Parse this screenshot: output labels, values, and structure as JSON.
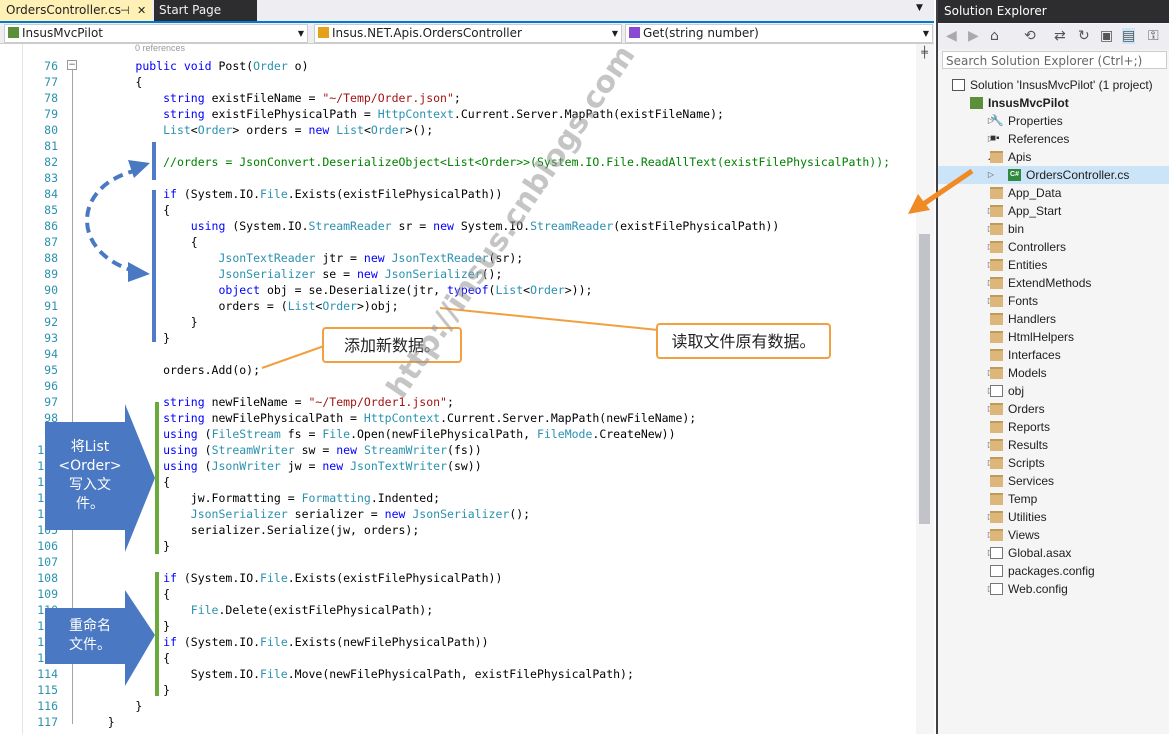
{
  "tabs": [
    {
      "label": "OrdersController.cs",
      "pin_glyph": "⊣",
      "close_glyph": "✕",
      "active": true
    },
    {
      "label": "Start Page",
      "active": false
    }
  ],
  "navbar": {
    "project": "InsusMvcPilot",
    "class": "Insus.NET.Apis.OrdersController",
    "member": "Get(string number)"
  },
  "editor": {
    "codelens": "0 references",
    "lines": [
      {
        "n": "76",
        "html": "        <span class=\"k\">public</span> <span class=\"k\">void</span> Post(<span class=\"t\">Order</span> o)"
      },
      {
        "n": "77",
        "html": "        {"
      },
      {
        "n": "78",
        "html": "            <span class=\"k\">string</span> existFileName = <span class=\"s\">\"~/Temp/Order.json\"</span>;"
      },
      {
        "n": "79",
        "html": "            <span class=\"k\">string</span> existFilePhysicalPath = <span class=\"t\">HttpContext</span>.Current.Server.MapPath(existFileName);"
      },
      {
        "n": "80",
        "html": "            <span class=\"t\">List</span>&lt;<span class=\"t\">Order</span>&gt; orders = <span class=\"k\">new</span> <span class=\"t\">List</span>&lt;<span class=\"t\">Order</span>&gt;();"
      },
      {
        "n": "81",
        "html": ""
      },
      {
        "n": "82",
        "html": "            <span class=\"c\">//orders = JsonConvert.DeserializeObject&lt;List&lt;Order&gt;&gt;(System.IO.File.ReadAllText(existFilePhysicalPath));</span>"
      },
      {
        "n": "83",
        "html": ""
      },
      {
        "n": "84",
        "html": "            <span class=\"k\">if</span> (System.IO.<span class=\"t\">File</span>.Exists(existFilePhysicalPath))"
      },
      {
        "n": "85",
        "html": "            {"
      },
      {
        "n": "86",
        "html": "                <span class=\"k\">using</span> (System.IO.<span class=\"t\">StreamReader</span> sr = <span class=\"k\">new</span> System.IO.<span class=\"t\">StreamReader</span>(existFilePhysicalPath))"
      },
      {
        "n": "87",
        "html": "                {"
      },
      {
        "n": "88",
        "html": "                    <span class=\"t\">JsonTextReader</span> jtr = <span class=\"k\">new</span> <span class=\"t\">JsonTextReader</span>(sr);"
      },
      {
        "n": "89",
        "html": "                    <span class=\"t\">JsonSerializer</span> se = <span class=\"k\">new</span> <span class=\"t\">JsonSerializer</span>();"
      },
      {
        "n": "90",
        "html": "                    <span class=\"k\">object</span> obj = se.Deserialize(jtr, <span class=\"k\">typeof</span>(<span class=\"t\">List</span>&lt;<span class=\"t\">Order</span>&gt;));"
      },
      {
        "n": "91",
        "html": "                    orders = (<span class=\"t\">List</span>&lt;<span class=\"t\">Order</span>&gt;)obj;"
      },
      {
        "n": "92",
        "html": "                }"
      },
      {
        "n": "93",
        "html": "            }"
      },
      {
        "n": "94",
        "html": ""
      },
      {
        "n": "95",
        "html": "            orders.Add(o);"
      },
      {
        "n": "96",
        "html": ""
      },
      {
        "n": "97",
        "html": "            <span class=\"k\">string</span> newFileName = <span class=\"s\">\"~/Temp/Order1.json\"</span>;"
      },
      {
        "n": "98",
        "html": "            <span class=\"k\">string</span> newFilePhysicalPath = <span class=\"t\">HttpContext</span>.Current.Server.MapPath(newFileName);"
      },
      {
        "n": "99",
        "html": "            <span class=\"k\">using</span> (<span class=\"t\">FileStream</span> fs = <span class=\"t\">File</span>.Open(newFilePhysicalPath, <span class=\"t\">FileMode</span>.CreateNew))"
      },
      {
        "n": "100",
        "html": "            <span class=\"k\">using</span> (<span class=\"t\">StreamWriter</span> sw = <span class=\"k\">new</span> <span class=\"t\">StreamWriter</span>(fs))"
      },
      {
        "n": "101",
        "html": "            <span class=\"k\">using</span> (<span class=\"t\">JsonWriter</span> jw = <span class=\"k\">new</span> <span class=\"t\">JsonTextWriter</span>(sw))"
      },
      {
        "n": "102",
        "html": "            {"
      },
      {
        "n": "103",
        "html": "                jw.Formatting = <span class=\"t\">Formatting</span>.Indented;"
      },
      {
        "n": "104",
        "html": "                <span class=\"t\">JsonSerializer</span> serializer = <span class=\"k\">new</span> <span class=\"t\">JsonSerializer</span>();"
      },
      {
        "n": "105",
        "html": "                serializer.Serialize(jw, orders);"
      },
      {
        "n": "106",
        "html": "            }"
      },
      {
        "n": "107",
        "html": ""
      },
      {
        "n": "108",
        "html": "            <span class=\"k\">if</span> (System.IO.<span class=\"t\">File</span>.Exists(existFilePhysicalPath))"
      },
      {
        "n": "109",
        "html": "            {"
      },
      {
        "n": "110",
        "html": "                <span class=\"t\">File</span>.Delete(existFilePhysicalPath);"
      },
      {
        "n": "111",
        "html": "            }"
      },
      {
        "n": "112",
        "html": "            <span class=\"k\">if</span> (System.IO.<span class=\"t\">File</span>.Exists(newFilePhysicalPath))"
      },
      {
        "n": "113",
        "html": "            {"
      },
      {
        "n": "114",
        "html": "                System.IO.<span class=\"t\">File</span>.Move(newFilePhysicalPath, existFilePhysicalPath);"
      },
      {
        "n": "115",
        "html": "            }"
      },
      {
        "n": "116",
        "html": "        }"
      },
      {
        "n": "117",
        "html": "    }"
      }
    ]
  },
  "annotations": {
    "callout_add": "添加新数据。",
    "callout_read": "读取文件原有数据。",
    "arrow_write": [
      "将List",
      "<Order>",
      "写入文",
      "件。"
    ],
    "arrow_rename": [
      "重命名",
      "文件。"
    ],
    "watermark": "http://insus.cnblogs.com",
    "colors": {
      "callout_border": "#f0a040",
      "big_arrow": "#4a78c2",
      "blue_bar": "#4e7cc6",
      "green_bar": "#6aaa3a",
      "orange_arrow": "#f08a24"
    }
  },
  "solution_explorer": {
    "title": "Solution Explorer",
    "search_placeholder": "Search Solution Explorer (Ctrl+;)",
    "toolbar_icons": [
      "back-icon",
      "forward-icon",
      "home-icon",
      "history-icon",
      "sync-icon",
      "refresh-icon",
      "collapse-all-icon",
      "show-all-files-icon",
      "properties-icon"
    ],
    "items": [
      {
        "label": "Solution 'InsusMvcPilot' (1 project)",
        "level": 0,
        "icon": "solution-icon",
        "expander": ""
      },
      {
        "label": "InsusMvcPilot",
        "level": 1,
        "icon": "project-icon",
        "expander": "◢",
        "bold": true
      },
      {
        "label": "Properties",
        "level": 2,
        "icon": "wrench-icon",
        "expander": "▷"
      },
      {
        "label": "References",
        "level": 2,
        "icon": "references-icon",
        "expander": "▷"
      },
      {
        "label": "Apis",
        "level": 2,
        "icon": "folder-icon",
        "expander": "◢"
      },
      {
        "label": "OrdersController.cs",
        "level": 3,
        "icon": "csharp-file-icon",
        "expander": "▷",
        "selected": true
      },
      {
        "label": "App_Data",
        "level": 2,
        "icon": "folder-icon",
        "expander": ""
      },
      {
        "label": "App_Start",
        "level": 2,
        "icon": "folder-icon",
        "expander": "▷"
      },
      {
        "label": "bin",
        "level": 2,
        "icon": "folder-icon",
        "expander": "▷"
      },
      {
        "label": "Controllers",
        "level": 2,
        "icon": "folder-icon",
        "expander": "▷"
      },
      {
        "label": "Entities",
        "level": 2,
        "icon": "folder-icon",
        "expander": "▷"
      },
      {
        "label": "ExtendMethods",
        "level": 2,
        "icon": "folder-icon",
        "expander": "▷"
      },
      {
        "label": "Fonts",
        "level": 2,
        "icon": "folder-icon",
        "expander": "▷"
      },
      {
        "label": "Handlers",
        "level": 2,
        "icon": "folder-icon",
        "expander": ""
      },
      {
        "label": "HtmlHelpers",
        "level": 2,
        "icon": "folder-icon",
        "expander": ""
      },
      {
        "label": "Interfaces",
        "level": 2,
        "icon": "folder-icon",
        "expander": ""
      },
      {
        "label": "Models",
        "level": 2,
        "icon": "folder-icon",
        "expander": "▷"
      },
      {
        "label": "obj",
        "level": 2,
        "icon": "hidden-folder-icon",
        "expander": "▷"
      },
      {
        "label": "Orders",
        "level": 2,
        "icon": "folder-icon",
        "expander": "▷"
      },
      {
        "label": "Reports",
        "level": 2,
        "icon": "folder-icon",
        "expander": ""
      },
      {
        "label": "Results",
        "level": 2,
        "icon": "folder-icon",
        "expander": "▷"
      },
      {
        "label": "Scripts",
        "level": 2,
        "icon": "folder-icon",
        "expander": "▷"
      },
      {
        "label": "Services",
        "level": 2,
        "icon": "folder-icon",
        "expander": ""
      },
      {
        "label": "Temp",
        "level": 2,
        "icon": "folder-icon",
        "expander": ""
      },
      {
        "label": "Utilities",
        "level": 2,
        "icon": "folder-icon",
        "expander": "▷"
      },
      {
        "label": "Views",
        "level": 2,
        "icon": "folder-icon",
        "expander": "▷"
      },
      {
        "label": "Global.asax",
        "level": 2,
        "icon": "asax-file-icon",
        "expander": "▷"
      },
      {
        "label": "packages.config",
        "level": 2,
        "icon": "config-file-icon",
        "expander": ""
      },
      {
        "label": "Web.config",
        "level": 2,
        "icon": "config-file-icon",
        "expander": "▷"
      }
    ]
  }
}
